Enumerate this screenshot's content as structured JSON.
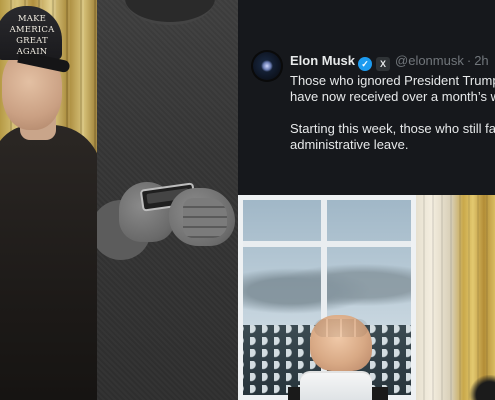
{
  "hat": {
    "line1": "MAKE AMERICA",
    "line2": "GREAT AGAIN"
  },
  "tweet": {
    "display_name": "Elon Musk",
    "handle": "@elonmusk",
    "separator": "·",
    "time": "2h",
    "verified_icon": "check-badge-icon",
    "x_icon": "x-logo-icon",
    "paragraphs": [
      [
        "Those who ignored President Trump’s email request",
        "have now received over a month’s warning."
      ],
      [
        "Starting this week, those who still fail to respond",
        "administrative leave."
      ]
    ]
  },
  "colors": {
    "tweet_bg": "#16181c",
    "text_primary": "#e7e9ea",
    "text_secondary": "#71767b",
    "verified_blue": "#1d9bf0"
  }
}
